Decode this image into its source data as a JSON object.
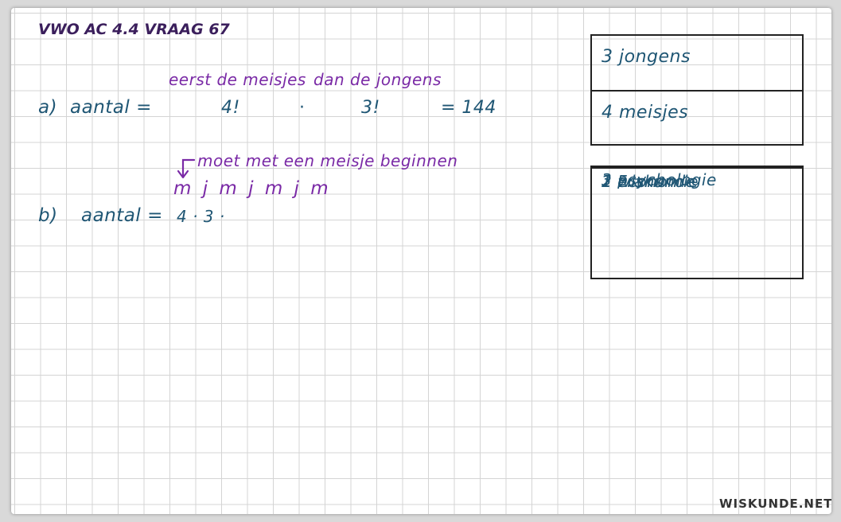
{
  "title": "VWO AC 4.4 VRAAG 67",
  "part_a": {
    "label": "a)",
    "lhs": "aantal =",
    "note_girls": "eerst de meisjes",
    "note_boys": "dan de jongens",
    "factor1": "4!",
    "times": "·",
    "factor2": "3!",
    "result": "= 144"
  },
  "part_b": {
    "label": "b)",
    "lhs": "aantal =",
    "note": "moet met een meisje beginnen",
    "sequence": "m j m j m j m",
    "calc": "4 · 3 ·"
  },
  "group_box": {
    "rows": [
      "3 jongens",
      "4 meisjes"
    ]
  },
  "subjects_box": {
    "rows": [
      "3 psychologie",
      "2 economie",
      "1 wiskunde",
      "1 Frans"
    ]
  },
  "brand": "WISKUNDE.NET",
  "colors": {
    "ink_dark": "#3b1f5c",
    "ink_purple": "#7a2aa6",
    "ink_teal": "#1f5674",
    "grid": "#d4d4d4"
  }
}
